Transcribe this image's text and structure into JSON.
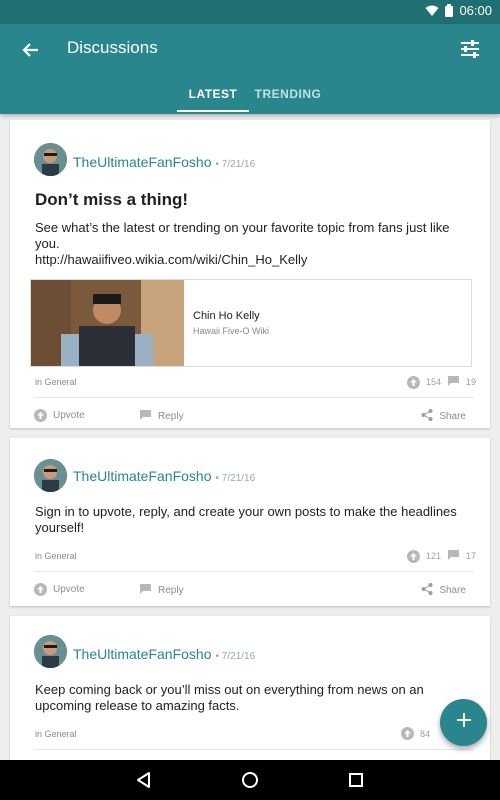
{
  "status": {
    "time": "06:00"
  },
  "appbar": {
    "title": "Discussions"
  },
  "tabs": [
    {
      "label": "LATEST"
    },
    {
      "label": "TRENDING"
    }
  ],
  "posts": [
    {
      "author": "TheUltimateFanFosho",
      "date": "• 7/21/16",
      "title": "Don’t miss a thing!",
      "body": "See what’s the latest or trending on your favorite topic from fans just like you.",
      "link": "http://hawaiifiveo.wikia.com/wiki/Chin_Ho_Kelly",
      "preview": {
        "title": "Chin Ho Kelly",
        "subtitle": "Hawaii Five-O Wiki"
      },
      "category": "in General",
      "upvotes": "154",
      "replies": "19"
    },
    {
      "author": "TheUltimateFanFosho",
      "date": "• 7/21/16",
      "body": "Sign in to upvote, reply, and create your own posts to make the headlines yourself!",
      "category": "in General",
      "upvotes": "121",
      "replies": "17"
    },
    {
      "author": "TheUltimateFanFosho",
      "date": "• 7/21/16",
      "body": "Keep coming back or you’ll miss out on everything from news on an upcoming release to amazing facts.",
      "category": "in General",
      "upvotes": "84"
    }
  ],
  "actions": {
    "upvote": "Upvote",
    "reply": "Reply",
    "share": "Share"
  },
  "colors": {
    "accent": "#29868c",
    "status_bar": "#1f6f73"
  }
}
